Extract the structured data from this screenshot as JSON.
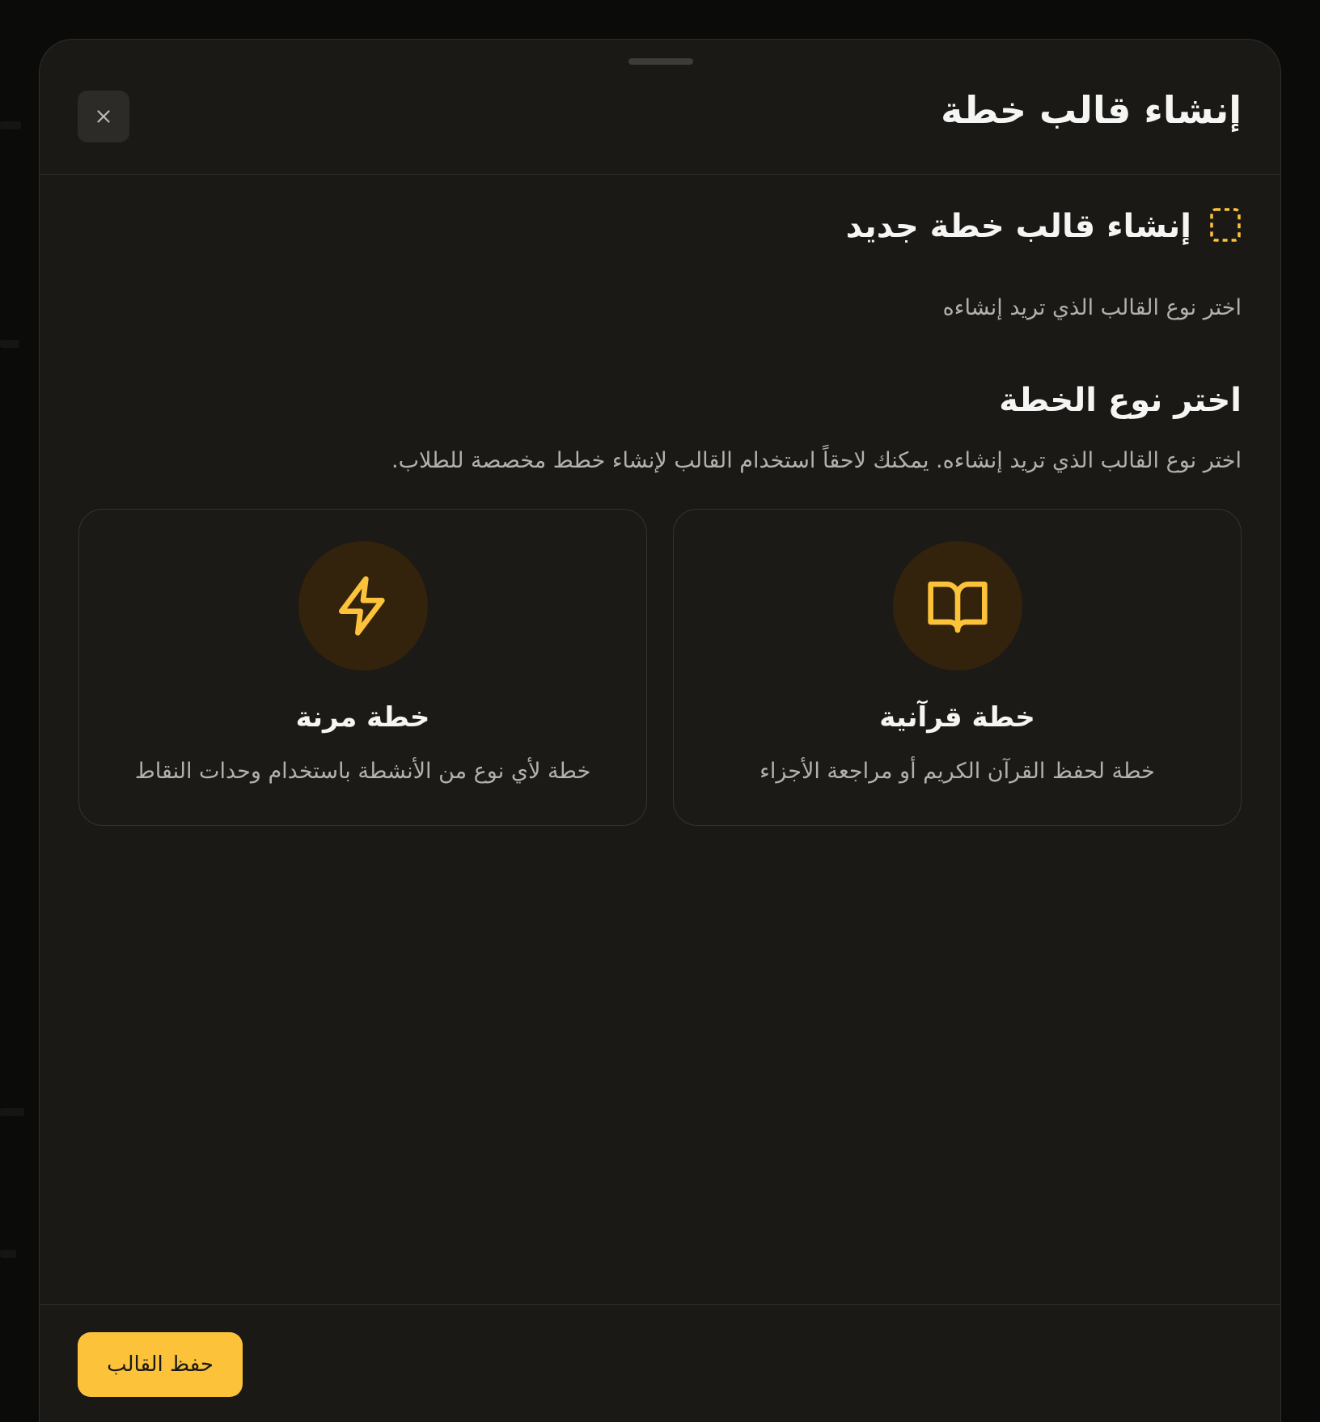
{
  "sheet": {
    "title": "إنشاء قالب خطة"
  },
  "section": {
    "icon": "dashed-square-icon",
    "title": "إنشاء قالب خطة جديد",
    "subtitle": "اختر نوع القالب الذي تريد إنشاءه"
  },
  "plan_type": {
    "title": "اختر نوع الخطة",
    "description": "اختر نوع القالب الذي تريد إنشاءه. يمكنك لاحقاً استخدام القالب لإنشاء خطط مخصصة للطلاب.",
    "cards": [
      {
        "icon": "book-open-icon",
        "title": "خطة قرآنية",
        "description": "خطة لحفظ القرآن الكريم أو مراجعة الأجزاء"
      },
      {
        "icon": "lightning-icon",
        "title": "خطة مرنة",
        "description": "خطة لأي نوع من الأنشطة باستخدام وحدات النقاط"
      }
    ]
  },
  "footer": {
    "save_label": "حفظ القالب"
  },
  "colors": {
    "accent": "#fcc23a",
    "icon_circle": "#33220c",
    "sheet_bg": "#1a1916"
  }
}
